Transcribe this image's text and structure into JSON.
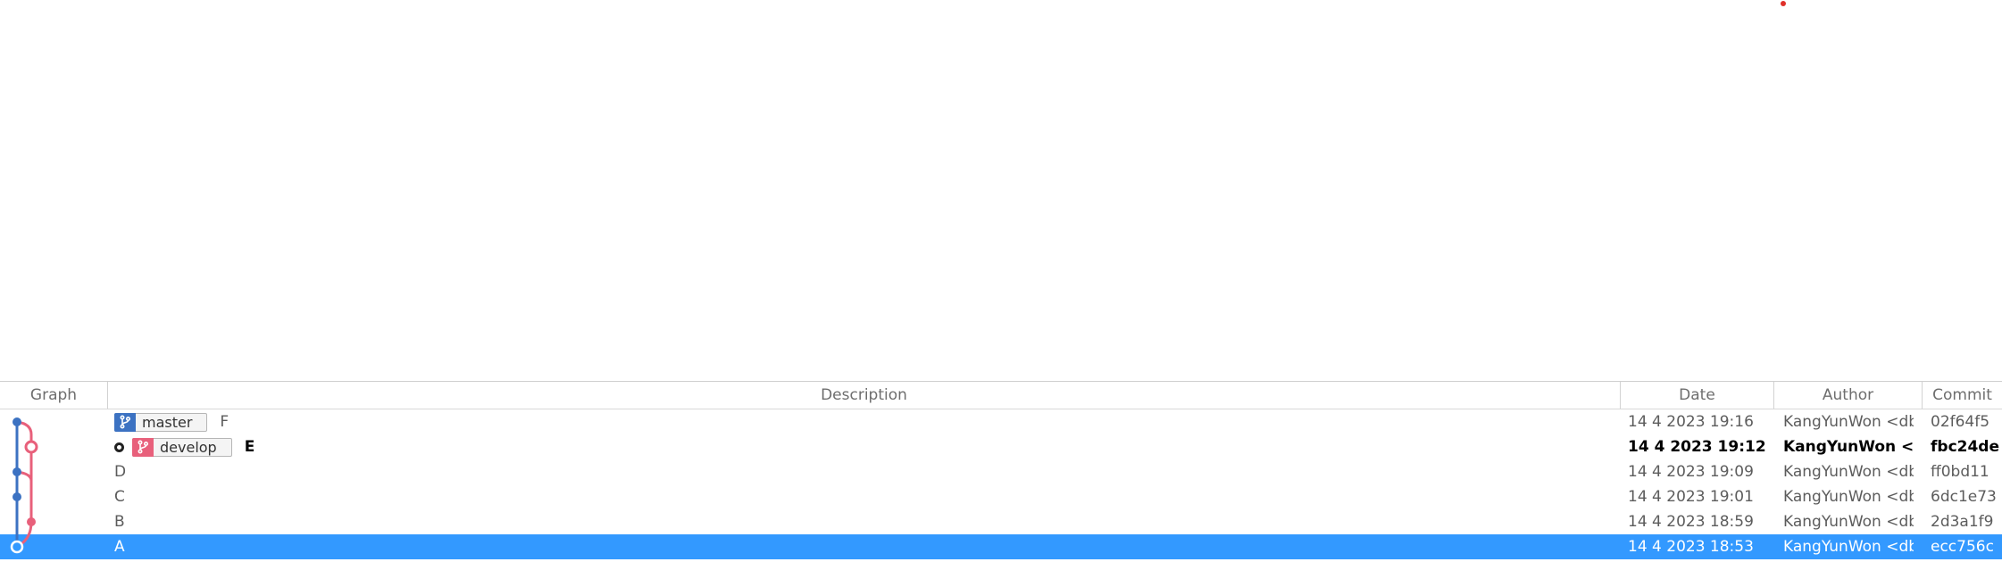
{
  "colors": {
    "selection": "#3399ff",
    "master_lane": "#3c72c2",
    "develop_lane": "#e8607b",
    "indicator_dot": "#e0302a"
  },
  "columns": {
    "graph": "Graph",
    "description": "Description",
    "date": "Date",
    "author": "Author",
    "commit": "Commit"
  },
  "commits": [
    {
      "branch": "master",
      "branch_icon": "branch-icon",
      "subject": "F",
      "date": "14 4 2023 19:16",
      "author": "KangYunWon <db",
      "hash": "02f64f5"
    },
    {
      "branch": "develop",
      "branch_icon": "branch-icon",
      "is_head": true,
      "subject": "E",
      "date": "14 4 2023 19:12",
      "author": "KangYunWon <d",
      "hash": "fbc24de"
    },
    {
      "subject": "D",
      "date": "14 4 2023 19:09",
      "author": "KangYunWon <db",
      "hash": "ff0bd11"
    },
    {
      "subject": "C",
      "date": "14 4 2023 19:01",
      "author": "KangYunWon <db",
      "hash": "6dc1e73"
    },
    {
      "subject": "B",
      "date": "14 4 2023 18:59",
      "author": "KangYunWon <db",
      "hash": "2d3a1f9"
    },
    {
      "subject": "A",
      "date": "14 4 2023 18:53",
      "author": "KangYunWon <db",
      "hash": "ecc756c",
      "selected": true
    }
  ]
}
